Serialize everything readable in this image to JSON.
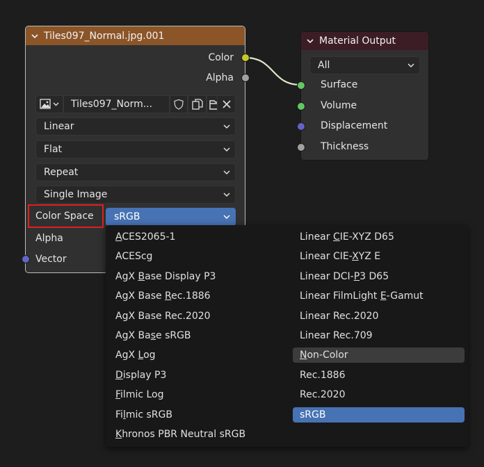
{
  "image_node": {
    "title": "Tiles097_Normal.jpg.001",
    "header_color": "#8b5528",
    "outputs": [
      "Color",
      "Alpha"
    ],
    "image_name": "Tiles097_Norm...",
    "interpolation": "Linear",
    "projection": "Flat",
    "extension": "Repeat",
    "source": "Single Image",
    "color_space_label": "Color Space",
    "color_space_value": "sRGB",
    "alpha_label": "Alpha",
    "vector_label": "Vector"
  },
  "material_output": {
    "title": "Material Output",
    "header_color": "#3c1d26",
    "target": "All",
    "inputs": [
      "Surface",
      "Volume",
      "Displacement",
      "Thickness"
    ]
  },
  "color_space_menu": {
    "left_column": [
      {
        "pre": "",
        "u": "A",
        "post": "CES2065-1"
      },
      {
        "pre": "ACEScg",
        "u": "",
        "post": ""
      },
      {
        "pre": "AgX ",
        "u": "B",
        "post": "ase Display P3"
      },
      {
        "pre": "AgX Base ",
        "u": "R",
        "post": "ec.1886"
      },
      {
        "pre": "AgX Base Rec.2020",
        "u": "",
        "post": ""
      },
      {
        "pre": "AgX Ba",
        "u": "s",
        "post": "e sRGB"
      },
      {
        "pre": "AgX ",
        "u": "L",
        "post": "og"
      },
      {
        "pre": "",
        "u": "D",
        "post": "isplay P3"
      },
      {
        "pre": "",
        "u": "F",
        "post": "ilmic Log"
      },
      {
        "pre": "Fi",
        "u": "l",
        "post": "mic sRGB"
      },
      {
        "pre": "",
        "u": "K",
        "post": "hronos PBR Neutral sRGB"
      }
    ],
    "right_column": [
      {
        "pre": "Linear ",
        "u": "C",
        "post": "IE-XYZ D65"
      },
      {
        "pre": "Linear CIE-",
        "u": "X",
        "post": "YZ E"
      },
      {
        "pre": "Linear DCI-",
        "u": "P",
        "post": "3 D65"
      },
      {
        "pre": "Linear FilmLight ",
        "u": "E",
        "post": "-Gamut"
      },
      {
        "pre": "Linear Rec.2020",
        "u": "",
        "post": ""
      },
      {
        "pre": "Linear Rec.709",
        "u": "",
        "post": ""
      },
      {
        "pre": "",
        "u": "N",
        "post": "on-Color"
      },
      {
        "pre": "Rec.1886",
        "u": "",
        "post": ""
      },
      {
        "pre": "Rec.2020",
        "u": "",
        "post": ""
      },
      {
        "pre": "sRGB",
        "u": "",
        "post": ""
      }
    ],
    "highlighted": "Non-Color",
    "selected": "sRGB"
  },
  "colors": {
    "accent_selected": "#4772b3",
    "highlight_box": "#e21f1f",
    "socket_color": "#c7c729",
    "socket_grey": "#a1a1a1",
    "socket_shader": "#63c763",
    "socket_vector": "#6363c7",
    "link": "#d9e8c7"
  }
}
